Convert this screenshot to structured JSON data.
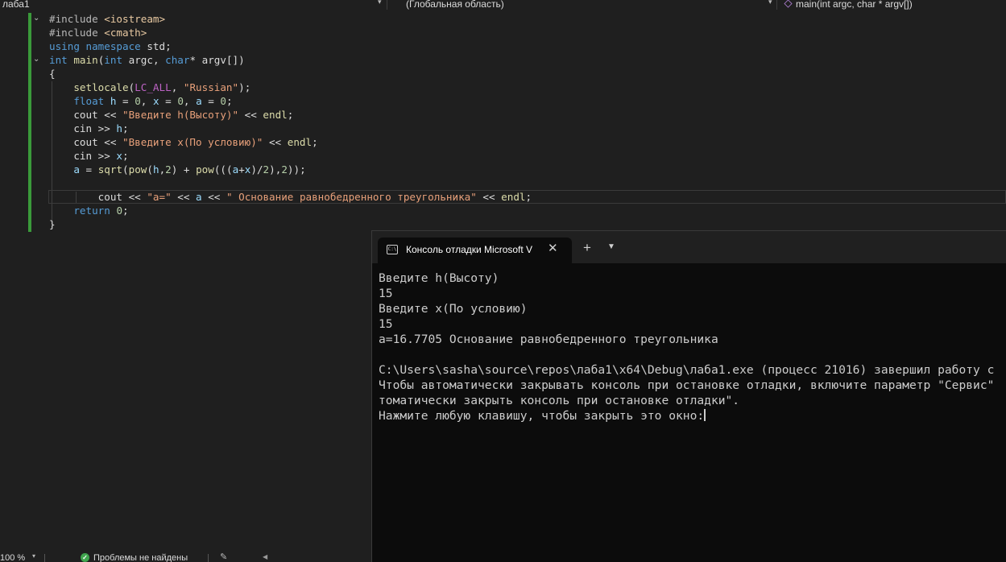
{
  "nav": {
    "project": "лаба1",
    "scope": "(Глобальная область)",
    "function": "main(int argc, char * argv[])",
    "function_icon": "method-icon"
  },
  "code": {
    "lines": [
      [
        {
          "t": "#include ",
          "c": "inc"
        },
        {
          "t": "<iostream>",
          "c": "hdr"
        }
      ],
      [
        {
          "t": "#include ",
          "c": "inc"
        },
        {
          "t": "<cmath>",
          "c": "hdr"
        }
      ],
      [
        {
          "t": "using",
          "c": "kw"
        },
        {
          "t": " ",
          "c": "plain"
        },
        {
          "t": "namespace",
          "c": "kw"
        },
        {
          "t": " std;",
          "c": "plain"
        }
      ],
      [
        {
          "t": "int",
          "c": "kw"
        },
        {
          "t": " ",
          "c": "plain"
        },
        {
          "t": "main",
          "c": "fn"
        },
        {
          "t": "(",
          "c": "plain"
        },
        {
          "t": "int",
          "c": "kw"
        },
        {
          "t": " argc, ",
          "c": "plain"
        },
        {
          "t": "char",
          "c": "kw"
        },
        {
          "t": "* argv[])",
          "c": "plain"
        }
      ],
      [
        {
          "t": "{",
          "c": "plain"
        }
      ],
      [
        {
          "t": "    ",
          "c": "plain"
        },
        {
          "t": "setlocale",
          "c": "fn"
        },
        {
          "t": "(",
          "c": "plain"
        },
        {
          "t": "LC_ALL",
          "c": "mac"
        },
        {
          "t": ", ",
          "c": "plain"
        },
        {
          "t": "\"Russian\"",
          "c": "str"
        },
        {
          "t": ");",
          "c": "plain"
        }
      ],
      [
        {
          "t": "    ",
          "c": "plain"
        },
        {
          "t": "float",
          "c": "kw"
        },
        {
          "t": " ",
          "c": "plain"
        },
        {
          "t": "h",
          "c": "var"
        },
        {
          "t": " = ",
          "c": "plain"
        },
        {
          "t": "0",
          "c": "num"
        },
        {
          "t": ", ",
          "c": "plain"
        },
        {
          "t": "x",
          "c": "var"
        },
        {
          "t": " = ",
          "c": "plain"
        },
        {
          "t": "0",
          "c": "num"
        },
        {
          "t": ", ",
          "c": "plain"
        },
        {
          "t": "a",
          "c": "var"
        },
        {
          "t": " = ",
          "c": "plain"
        },
        {
          "t": "0",
          "c": "num"
        },
        {
          "t": ";",
          "c": "plain"
        }
      ],
      [
        {
          "t": "    cout << ",
          "c": "plain"
        },
        {
          "t": "\"Введите h(Высоту)\"",
          "c": "str"
        },
        {
          "t": " << ",
          "c": "plain"
        },
        {
          "t": "endl",
          "c": "fn"
        },
        {
          "t": ";",
          "c": "plain"
        }
      ],
      [
        {
          "t": "    cin >> ",
          "c": "plain"
        },
        {
          "t": "h",
          "c": "var"
        },
        {
          "t": ";",
          "c": "plain"
        }
      ],
      [
        {
          "t": "    cout << ",
          "c": "plain"
        },
        {
          "t": "\"Введите x(По условию)\"",
          "c": "str"
        },
        {
          "t": " << ",
          "c": "plain"
        },
        {
          "t": "endl",
          "c": "fn"
        },
        {
          "t": ";",
          "c": "plain"
        }
      ],
      [
        {
          "t": "    cin >> ",
          "c": "plain"
        },
        {
          "t": "x",
          "c": "var"
        },
        {
          "t": ";",
          "c": "plain"
        }
      ],
      [
        {
          "t": "    ",
          "c": "plain"
        },
        {
          "t": "a",
          "c": "var"
        },
        {
          "t": " = ",
          "c": "plain"
        },
        {
          "t": "sqrt",
          "c": "fn"
        },
        {
          "t": "(",
          "c": "plain"
        },
        {
          "t": "pow",
          "c": "fn"
        },
        {
          "t": "(",
          "c": "plain"
        },
        {
          "t": "h",
          "c": "var"
        },
        {
          "t": ",",
          "c": "plain"
        },
        {
          "t": "2",
          "c": "num"
        },
        {
          "t": ") + ",
          "c": "plain"
        },
        {
          "t": "pow",
          "c": "fn"
        },
        {
          "t": "(((",
          "c": "plain"
        },
        {
          "t": "a",
          "c": "var"
        },
        {
          "t": "+",
          "c": "plain"
        },
        {
          "t": "x",
          "c": "var"
        },
        {
          "t": ")/",
          "c": "plain"
        },
        {
          "t": "2",
          "c": "num"
        },
        {
          "t": "),",
          "c": "plain"
        },
        {
          "t": "2",
          "c": "num"
        },
        {
          "t": "));",
          "c": "plain"
        }
      ],
      [],
      [
        {
          "t": "        cout << ",
          "c": "plain"
        },
        {
          "t": "\"a=\"",
          "c": "str"
        },
        {
          "t": " << ",
          "c": "plain"
        },
        {
          "t": "a",
          "c": "var"
        },
        {
          "t": " << ",
          "c": "plain"
        },
        {
          "t": "\" Основание равнобедренного треугольника\"",
          "c": "str"
        },
        {
          "t": " << ",
          "c": "plain"
        },
        {
          "t": "endl",
          "c": "fn"
        },
        {
          "t": ";",
          "c": "plain"
        }
      ],
      [
        {
          "t": "    ",
          "c": "plain"
        },
        {
          "t": "return",
          "c": "kw"
        },
        {
          "t": " ",
          "c": "plain"
        },
        {
          "t": "0",
          "c": "num"
        },
        {
          "t": ";",
          "c": "plain"
        }
      ],
      [
        {
          "t": "}",
          "c": "plain"
        }
      ]
    ]
  },
  "console": {
    "tab_title": "Консоль отладки Microsoft V",
    "close_glyph": "✕",
    "add_glyph": "+",
    "dropdown_glyph": "⌄",
    "icon_label": "C:\\",
    "output": [
      "Введите h(Высоту)",
      "15",
      "Введите x(По условию)",
      "15",
      "a=16.7705 Основание равнобедренного треугольника",
      "",
      "C:\\Users\\sasha\\source\\repos\\лаба1\\x64\\Debug\\лаба1.exe (процесс 21016) завершил работу с",
      "Чтобы автоматически закрывать консоль при остановке отладки, включите параметр \"Сервис\"",
      "томатически закрыть консоль при остановке отладки\".",
      "Нажмите любую клавишу, чтобы закрыть это окно:"
    ]
  },
  "status": {
    "zoom": "100 %",
    "problems": "Проблемы не найдены"
  }
}
